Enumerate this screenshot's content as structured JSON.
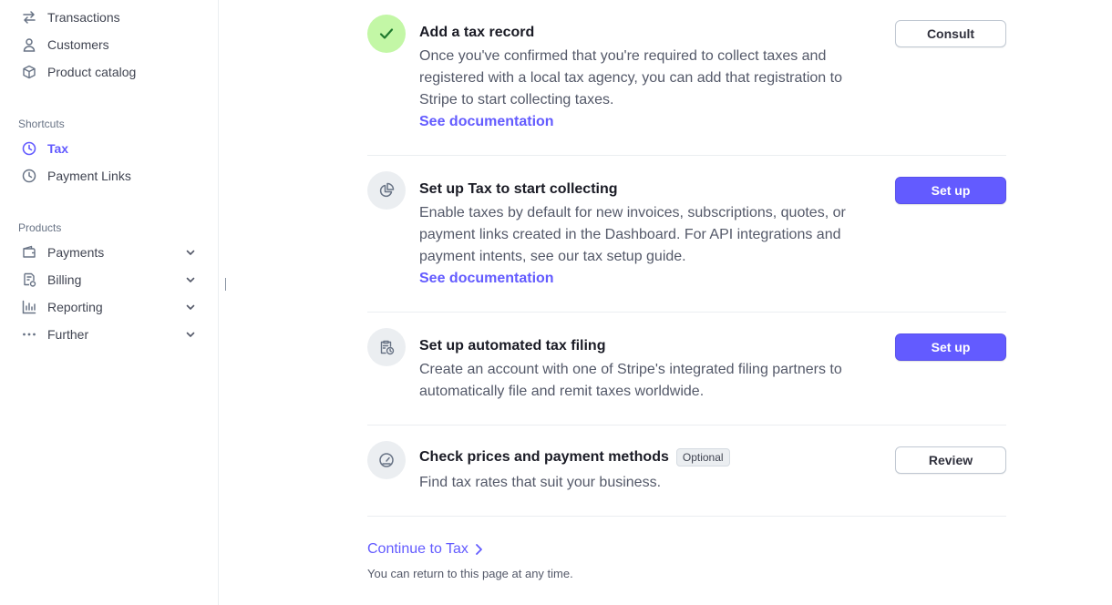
{
  "sidebar": {
    "top_items": [
      {
        "label": "Transactions",
        "icon": "arrows-exchange-icon"
      },
      {
        "label": "Customers",
        "icon": "person-icon"
      },
      {
        "label": "Product catalog",
        "icon": "box-icon"
      }
    ],
    "shortcuts_label": "Shortcuts",
    "shortcuts": [
      {
        "label": "Tax",
        "icon": "clock-icon",
        "active": true
      },
      {
        "label": "Payment Links",
        "icon": "clock-icon",
        "active": false
      }
    ],
    "products_label": "Products",
    "products": [
      {
        "label": "Payments",
        "icon": "wallet-icon"
      },
      {
        "label": "Billing",
        "icon": "invoice-icon"
      },
      {
        "label": "Reporting",
        "icon": "bar-chart-icon"
      },
      {
        "label": "Further",
        "icon": "more-dots-icon"
      }
    ]
  },
  "steps": [
    {
      "title": "Add a tax record",
      "description": "Once you've confirmed that you're required to collect taxes and registered with a local tax agency, you can add that registration to Stripe to start collecting taxes.",
      "link": "See documentation",
      "button": "Consult",
      "completed": true
    },
    {
      "title": "Set up Tax to start collecting",
      "description": "Enable taxes by default for new invoices, subscriptions, quotes, or payment links created in the Dashboard. For API integrations and payment intents, see our tax setup guide.",
      "link": "See documentation",
      "button": "Set up",
      "completed": false
    },
    {
      "title": "Set up automated tax filing",
      "description": "Create an account with one of Stripe's integrated filing partners to automatically file and remit taxes worldwide.",
      "button": "Set up",
      "completed": false
    },
    {
      "title": "Check prices and payment methods",
      "badge": "Optional",
      "description": "Find tax rates that suit your business.",
      "button": "Review",
      "completed": false
    }
  ],
  "continue_label": "Continue to Tax",
  "footnote": "You can return to this page at any time.",
  "colors": {
    "accent": "#635bff",
    "done_bg": "#c3f7a6",
    "done_check": "#1f7a2e"
  }
}
